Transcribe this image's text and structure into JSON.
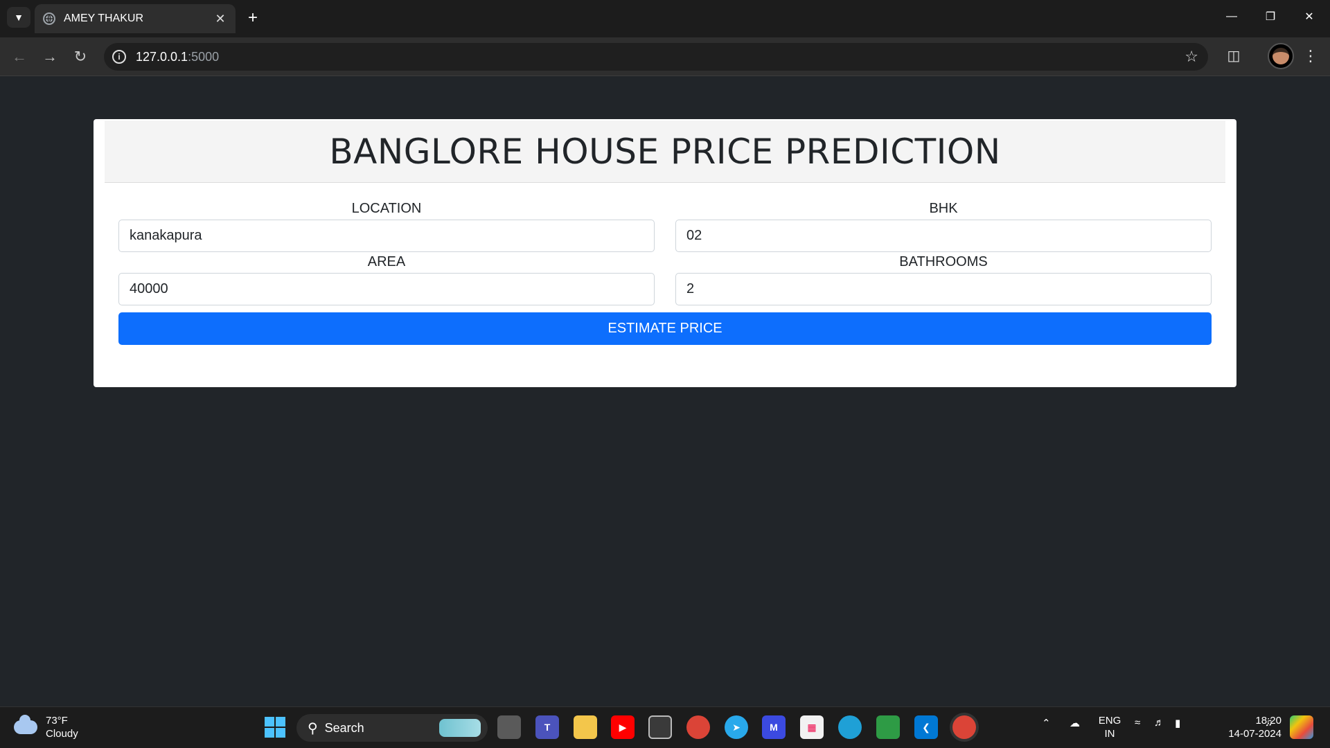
{
  "browser": {
    "tab_title": "AMEY THAKUR",
    "url_host": "127.0.0.1",
    "url_port": ":5000"
  },
  "page": {
    "heading": "BANGLORE HOUSE PRICE PREDICTION",
    "location_label": "LOCATION",
    "location_value": "kanakapura",
    "bhk_label": "BHK",
    "bhk_value": "02",
    "area_label": "AREA",
    "area_value": "40000",
    "bathrooms_label": "BATHROOMS",
    "bathrooms_value": "2",
    "estimate_button": "ESTIMATE PRICE",
    "button_color": "#0d6efd",
    "page_background": "#212529"
  },
  "taskbar": {
    "temperature": "73°F",
    "weather": "Cloudy",
    "search_label": "Search",
    "lang_line1": "ENG",
    "lang_line2": "IN",
    "time": "18:20",
    "date": "14-07-2024"
  }
}
